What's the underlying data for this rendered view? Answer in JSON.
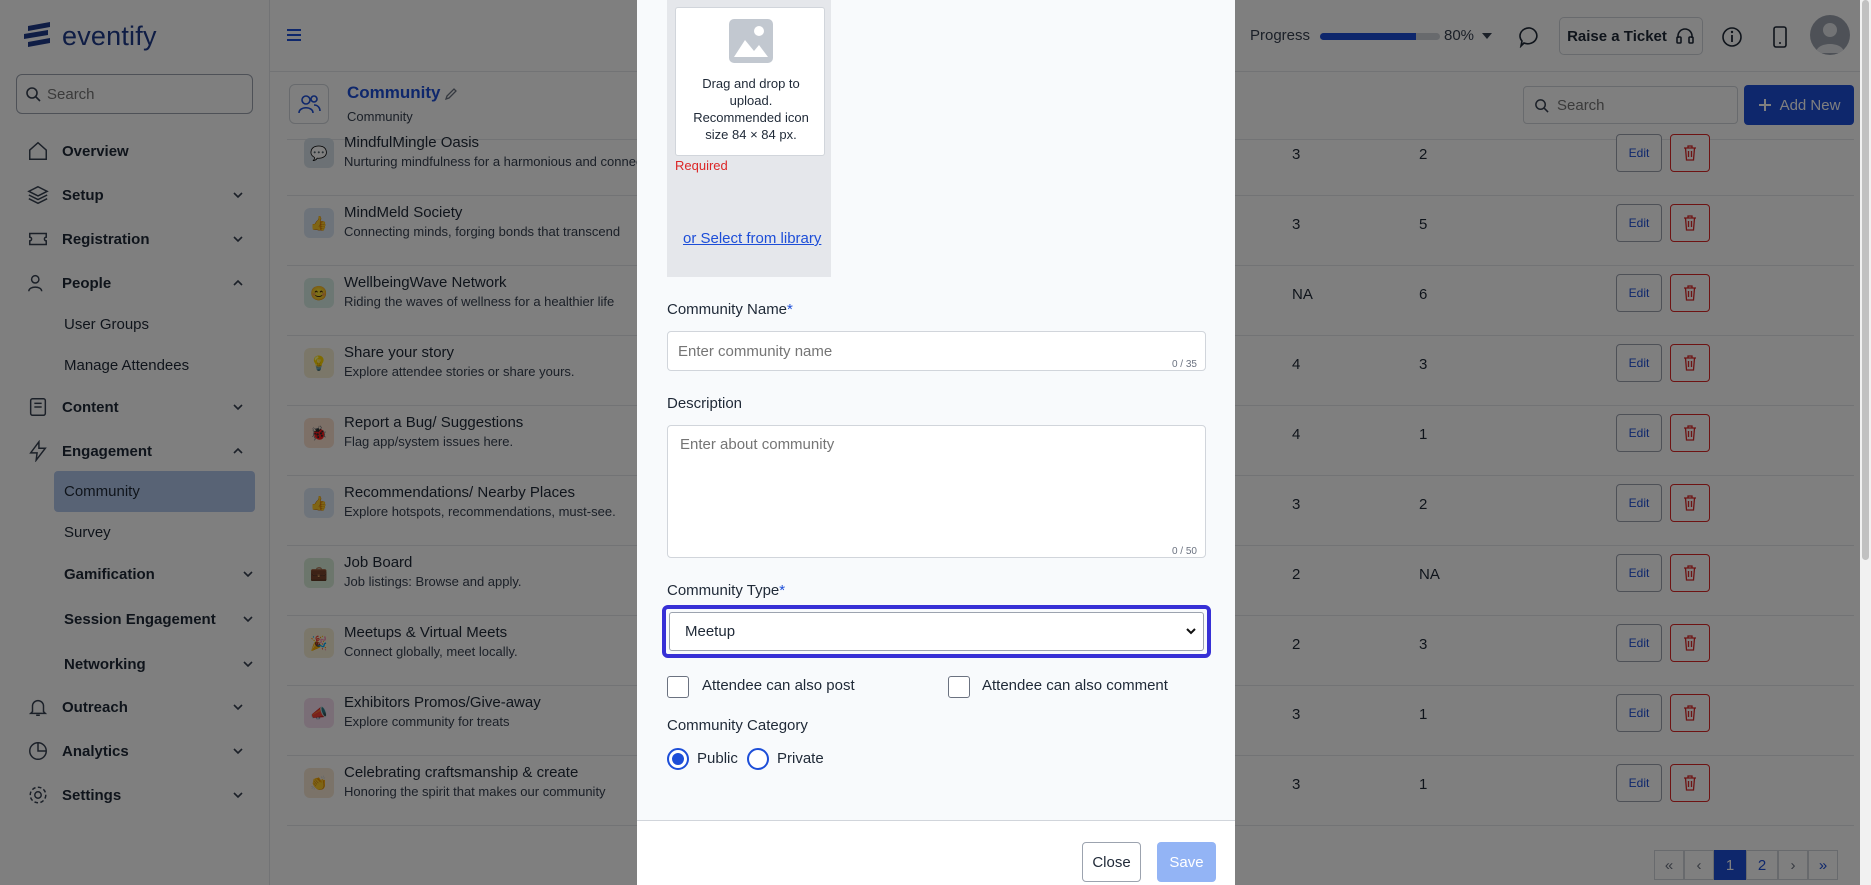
{
  "app": {
    "logo_text": "eventify",
    "search_placeholder": "Search"
  },
  "sidebar": {
    "items": [
      {
        "label": "Overview"
      },
      {
        "label": "Setup"
      },
      {
        "label": "Registration"
      },
      {
        "label": "People"
      },
      {
        "label": "User Groups"
      },
      {
        "label": "Manage Attendees"
      },
      {
        "label": "Content"
      },
      {
        "label": "Engagement"
      },
      {
        "label": "Community"
      },
      {
        "label": "Survey"
      },
      {
        "label": "Gamification"
      },
      {
        "label": "Session Engagement"
      },
      {
        "label": "Networking"
      },
      {
        "label": "Outreach"
      },
      {
        "label": "Analytics"
      },
      {
        "label": "Settings"
      }
    ]
  },
  "topbar": {
    "progress_label": "Progress",
    "progress_value": 0.8,
    "progress_pct": "80%",
    "ticket_label": "Raise a Ticket"
  },
  "page": {
    "title": "Community",
    "subtitle": "Community",
    "search_placeholder": "Search",
    "add_new_label": "Add New"
  },
  "rows": [
    {
      "name": "MindfulMingle Oasis",
      "desc": "Nurturing mindfulness for a harmonious and connec",
      "c1": "3",
      "c2": "2",
      "color": "#d8e3ea",
      "icon": "💬"
    },
    {
      "name": "MindMeld Society",
      "desc": "Connecting minds, forging bonds that transcend",
      "c1": "3",
      "c2": "5",
      "color": "#dbe6f5",
      "icon": "👍"
    },
    {
      "name": "WellbeingWave Network",
      "desc": "Riding the waves of wellness for a healthier life",
      "c1": "NA",
      "c2": "6",
      "color": "#d9efe6",
      "icon": "😊"
    },
    {
      "name": "Share your story",
      "desc": "Explore attendee stories or share yours.",
      "c1": "4",
      "c2": "3",
      "color": "#f6efd2",
      "icon": "💡"
    },
    {
      "name": "Report a Bug/ Suggestions",
      "desc": "Flag app/system issues here.",
      "c1": "4",
      "c2": "1",
      "color": "#fae0cf",
      "icon": "🐞"
    },
    {
      "name": "Recommendations/ Nearby Places",
      "desc": "Explore hotspots, recommendations, must-see.",
      "c1": "3",
      "c2": "2",
      "color": "#dde8f7",
      "icon": "👍"
    },
    {
      "name": "Job Board",
      "desc": "Job listings: Browse and apply.",
      "c1": "2",
      "c2": "NA",
      "color": "#d8ecd8",
      "icon": "💼"
    },
    {
      "name": "Meetups & Virtual Meets",
      "desc": "Connect globally, meet locally.",
      "c1": "2",
      "c2": "3",
      "color": "#f7efd4",
      "icon": "🎉"
    },
    {
      "name": "Exhibitors Promos/Give-away",
      "desc": "Explore community for treats",
      "c1": "3",
      "c2": "1",
      "color": "#f5dcef",
      "icon": "📣"
    },
    {
      "name": "Celebrating craftsmanship & create",
      "desc": "Honoring the spirit that makes our community",
      "c1": "3",
      "c2": "1",
      "color": "#f7e6d2",
      "icon": "👏"
    }
  ],
  "table": {
    "edit_label": "Edit"
  },
  "pagination": {
    "first": "«",
    "prev": "‹",
    "page1": "1",
    "page2": "2",
    "next": "›",
    "last": "»"
  },
  "modal": {
    "upload_text": "Drag and drop to upload. Recommended icon size 84 × 84 px.",
    "required": "Required",
    "library_link": "or Select from library",
    "name_label": "Community Name",
    "name_placeholder": "Enter community name",
    "name_count": "0 / 35",
    "desc_label": "Description",
    "desc_placeholder": "Enter about community",
    "desc_count": "0 / 50",
    "type_label": "Community Type",
    "type_value": "Meetup",
    "post_label": "Attendee can also post",
    "comment_label": "Attendee can also comment",
    "category_label": "Community Category",
    "public_label": "Public",
    "private_label": "Private",
    "close_label": "Close",
    "save_label": "Save"
  },
  "colors": {
    "accent": "#1d4ed8",
    "focus": "#3730d6",
    "danger": "#dc2626"
  }
}
